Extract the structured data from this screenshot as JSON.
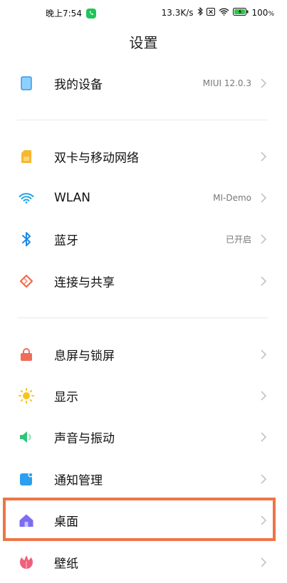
{
  "status_bar": {
    "time": "晚上7:54",
    "network_speed": "13.3K/s",
    "battery": "100",
    "battery_unit": "%",
    "icons": [
      "wechat-icon",
      "bluetooth-icon",
      "sim-off-icon",
      "wifi-icon",
      "battery-icon"
    ]
  },
  "page": {
    "title": "设置"
  },
  "items": [
    {
      "label": "我的设备",
      "value": "MIUI 12.0.3",
      "icon": "device-icon",
      "color": "#2f9bf0"
    },
    {
      "label": "双卡与移动网络",
      "value": "",
      "icon": "sim-card-icon",
      "color": "#f7b731"
    },
    {
      "label": "WLAN",
      "value": "MI-Demo",
      "icon": "wifi-icon",
      "color": "#1fa7e8"
    },
    {
      "label": "蓝牙",
      "value": "已开启",
      "icon": "bluetooth-icon",
      "color": "#1e88e5"
    },
    {
      "label": "连接与共享",
      "value": "",
      "icon": "share-icon",
      "color": "#f06c4a"
    },
    {
      "label": "息屏与锁屏",
      "value": "",
      "icon": "lock-icon",
      "color": "#f06c5a"
    },
    {
      "label": "显示",
      "value": "",
      "icon": "sun-icon",
      "color": "#f9c31b"
    },
    {
      "label": "声音与振动",
      "value": "",
      "icon": "speaker-icon",
      "color": "#2ec77a"
    },
    {
      "label": "通知管理",
      "value": "",
      "icon": "notification-icon",
      "color": "#2b9ff0"
    },
    {
      "label": "桌面",
      "value": "",
      "icon": "home-icon",
      "color": "#7b6cf2"
    },
    {
      "label": "壁纸",
      "value": "",
      "icon": "flower-icon",
      "color": "#f0607a"
    }
  ],
  "highlight_color": "#ef7445"
}
